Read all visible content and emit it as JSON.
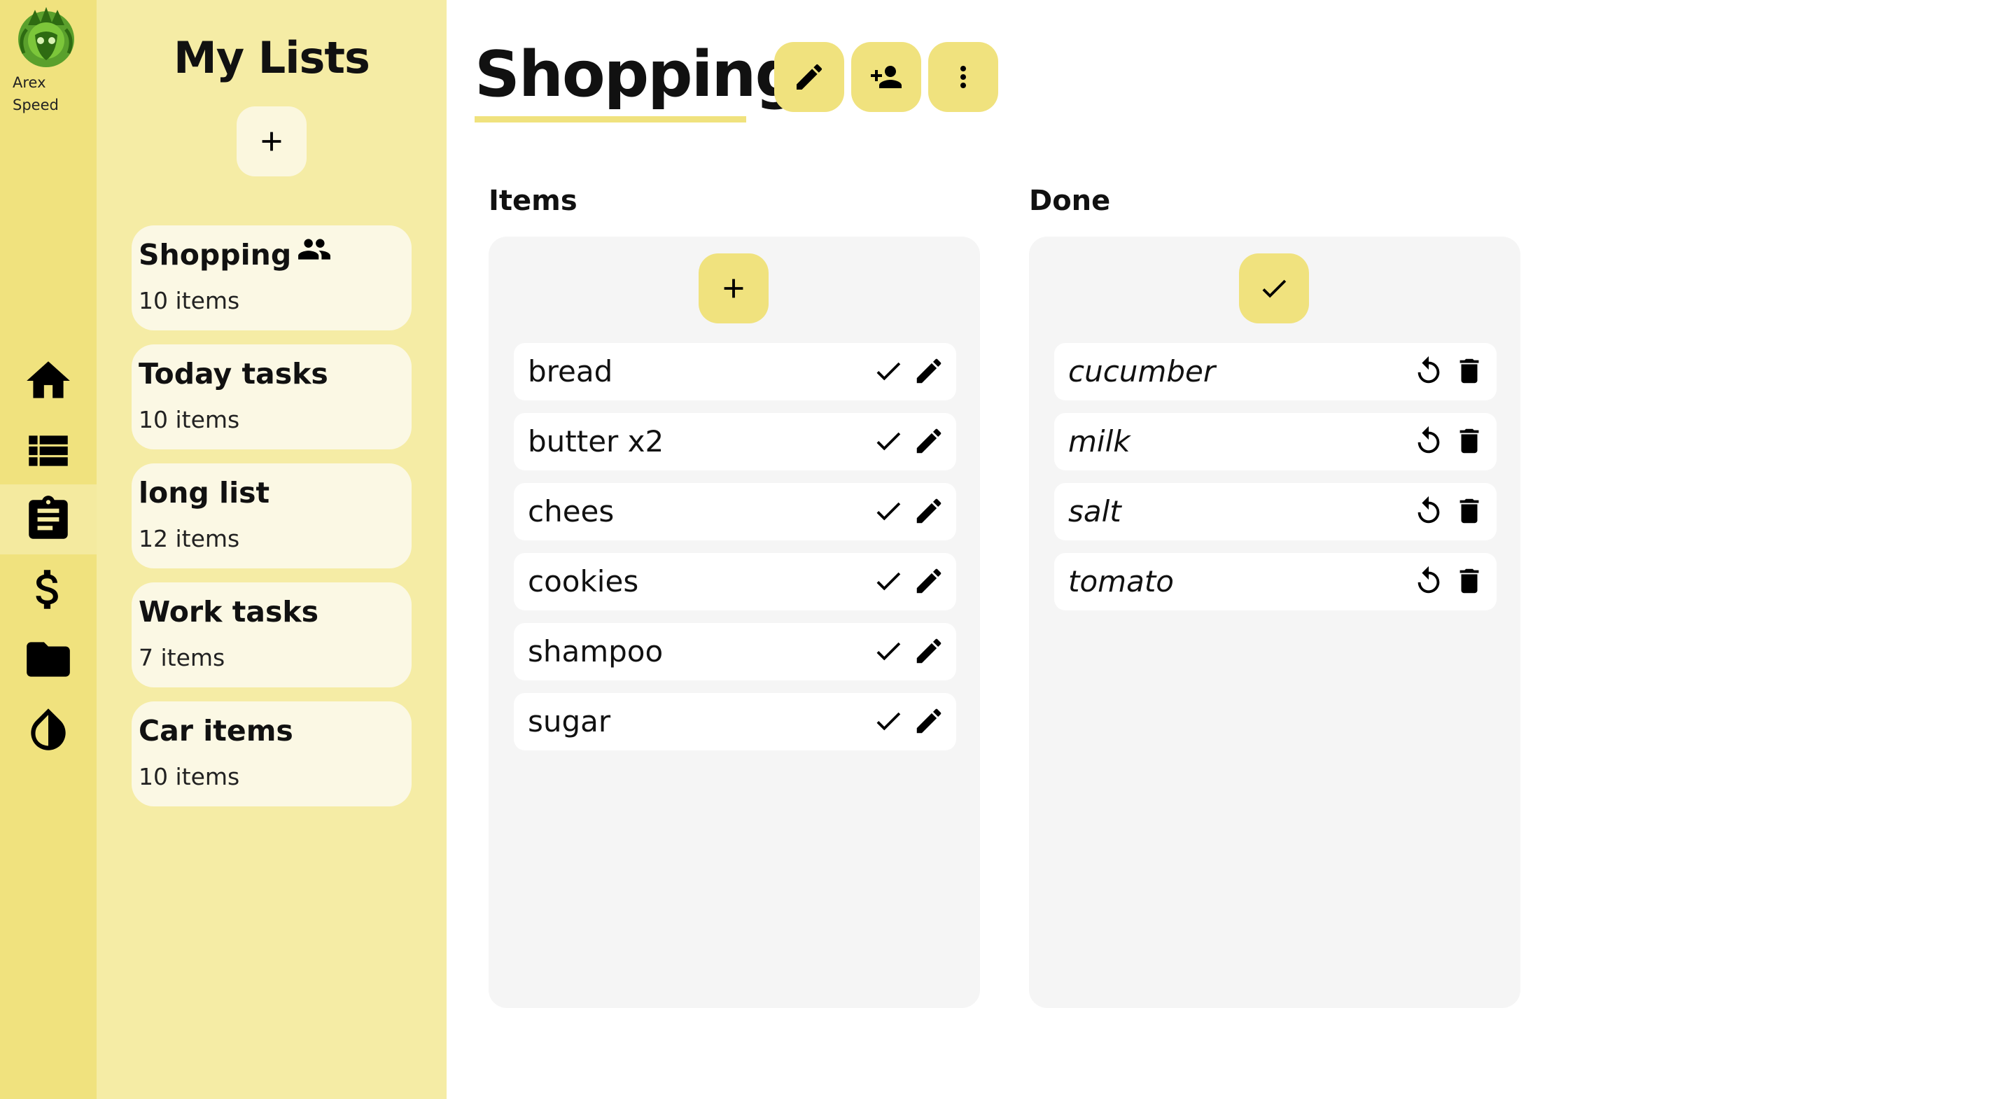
{
  "user": {
    "name_line1": "Arex",
    "name_line2": "Speed"
  },
  "nav": [
    {
      "icon": "home-icon",
      "active": false
    },
    {
      "icon": "list-icon",
      "active": false
    },
    {
      "icon": "clipboard-icon",
      "active": true
    },
    {
      "icon": "dollar-icon",
      "active": false
    },
    {
      "icon": "folder-icon",
      "active": false
    },
    {
      "icon": "contrast-icon",
      "active": false
    }
  ],
  "sidebar": {
    "title": "My Lists",
    "lists": [
      {
        "name": "Shopping",
        "count": "10 items",
        "shared": true
      },
      {
        "name": "Today tasks",
        "count": "10 items",
        "shared": false
      },
      {
        "name": "long list",
        "count": "12 items",
        "shared": false
      },
      {
        "name": "Work tasks",
        "count": "7 items",
        "shared": false
      },
      {
        "name": "Car items",
        "count": "10 items",
        "shared": false
      }
    ]
  },
  "main": {
    "title": "Shopping",
    "items_title": "Items",
    "done_title": "Done",
    "items": [
      "bread",
      "butter x2",
      "chees",
      "cookies",
      "shampoo",
      "sugar"
    ],
    "done": [
      "cucumber",
      "milk",
      "salt",
      "tomato"
    ]
  },
  "colors": {
    "rail": "#f0e27e",
    "panel": "#f5eca5",
    "card": "#fbf8e4",
    "accent": "#f0e27e",
    "column": "#f5f5f5"
  }
}
